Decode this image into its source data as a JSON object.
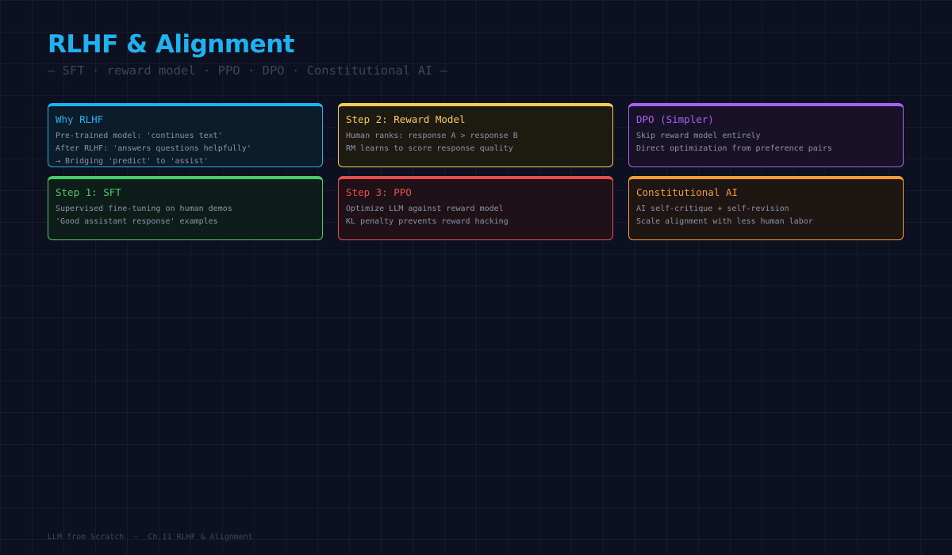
{
  "header": {
    "title": "RLHF & Alignment",
    "subtitle": "— SFT · reward model · PPO · DPO · Constitutional AI —",
    "title_color": "#1cb3f0",
    "subtitle_color": "#3c4560"
  },
  "cards": [
    {
      "title": "Why RLHF",
      "lines": [
        "Pre-trained model: 'continues text'",
        "After RLHF: 'answers questions helpfully'",
        "→ Bridging 'predict' to 'assist'"
      ],
      "accent": "#1ab4f2",
      "background": "#0b1c2b"
    },
    {
      "title": "Step 2: Reward Model",
      "lines": [
        "Human ranks: response A > response B",
        "RM learns to score response quality"
      ],
      "accent": "#f7cb52",
      "background": "#1d1a12"
    },
    {
      "title": "DPO (Simpler)",
      "lines": [
        "Skip reward model entirely",
        "Direct optimization from preference pairs"
      ],
      "accent": "#ab60ee",
      "background": "#181228"
    },
    {
      "title": "Step 1: SFT",
      "lines": [
        "Supervised fine-tuning on human demos",
        "'Good assistant response' examples"
      ],
      "accent": "#48cb6c",
      "background": "#0d1d1a"
    },
    {
      "title": "Step 3: PPO",
      "lines": [
        "Optimize LLM against reward model",
        "KL penalty prevents reward hacking"
      ],
      "accent": "#ec4d53",
      "background": "#1e1118"
    },
    {
      "title": "Constitutional AI",
      "lines": [
        "AI self-critique + self-revision",
        "Scale alignment with less human labor"
      ],
      "accent": "#f69a3b",
      "background": "#1d1612"
    }
  ],
  "footer": {
    "book": "LLM from Scratch",
    "separator": "·",
    "chapter": "Ch.11 RLHF & Alignment",
    "color": "#3e465e"
  }
}
